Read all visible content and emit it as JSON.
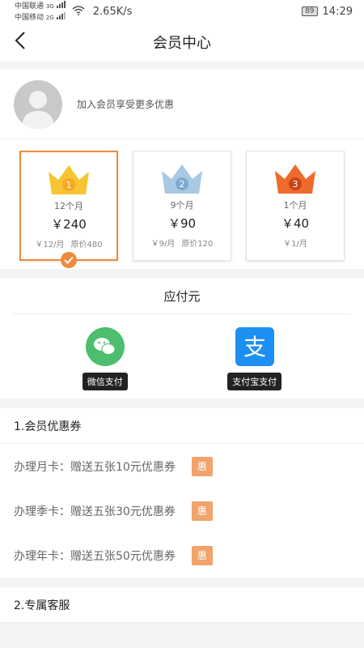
{
  "status": {
    "carrier1": "中国联通",
    "carrier1_net": "3G",
    "carrier2": "中国移动",
    "carrier2_net": "2G",
    "speed": "2.65K/s",
    "battery": "89",
    "time": "14:29"
  },
  "nav": {
    "title": "会员中心"
  },
  "profile": {
    "prompt": "加入会员享受更多优惠"
  },
  "plans": [
    {
      "badge": "1",
      "duration": "12个月",
      "price": "￥240",
      "per": "￥12/月",
      "orig": "原价480",
      "crown_color": "#f6c531",
      "selected": true
    },
    {
      "badge": "2",
      "duration": "9个月",
      "price": "￥90",
      "per": "￥9/月",
      "orig": "原价120",
      "crown_color": "#a9c8e2",
      "selected": false
    },
    {
      "badge": "3",
      "duration": "1个月",
      "price": "￥40",
      "per": "￥1/月",
      "orig": "",
      "crown_color": "#ef6a2d",
      "selected": false
    }
  ],
  "payment": {
    "title": "应付元",
    "wechat": "微信支付",
    "alipay": "支付宝支付"
  },
  "coupons": {
    "title": "1.会员优惠券",
    "items": [
      {
        "text": "办理月卡：赠送五张10元优惠券",
        "badge": "惠"
      },
      {
        "text": "办理季卡：赠送五张30元优惠券",
        "badge": "惠"
      },
      {
        "text": "办理年卡：赠送五张50元优惠券",
        "badge": "惠"
      }
    ]
  },
  "service": {
    "title": "2.专属客服"
  },
  "colors": {
    "accent": "#ef8a3c",
    "wechat": "#4cbe6e",
    "alipay": "#1d8ff3",
    "badge": "#f0a36a"
  }
}
